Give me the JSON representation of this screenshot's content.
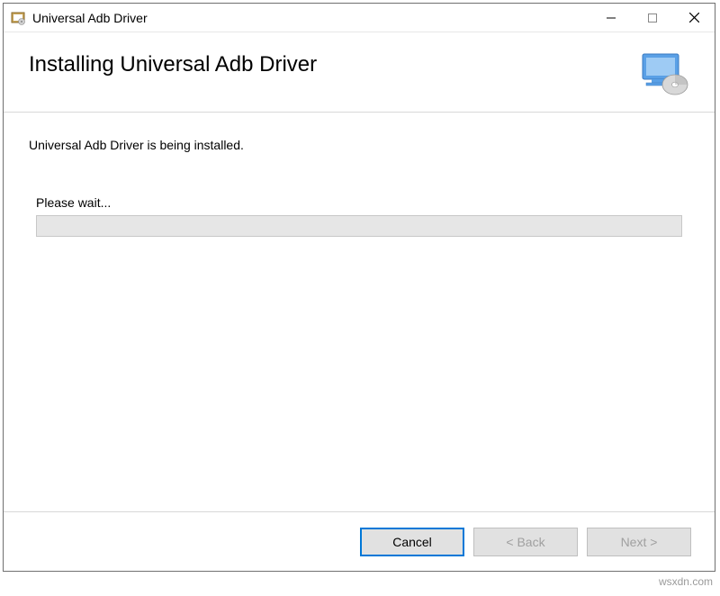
{
  "titlebar": {
    "title": "Universal Adb Driver"
  },
  "header": {
    "title": "Installing Universal Adb Driver"
  },
  "content": {
    "status": "Universal Adb Driver is being installed.",
    "wait": "Please wait..."
  },
  "footer": {
    "cancel": "Cancel",
    "back": "< Back",
    "next": "Next >"
  },
  "watermark": "wsxdn.com"
}
